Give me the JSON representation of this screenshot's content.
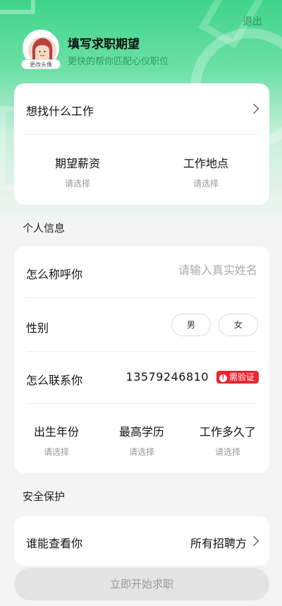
{
  "header": {
    "logout": "退出",
    "avatar_tag": "更改头像",
    "title": "填写求职期望",
    "subtitle": "更快的帮你匹配心仪职位"
  },
  "job_card": {
    "what_job": "想找什么工作",
    "salary_label": "期望薪资",
    "salary_value": "请选择",
    "location_label": "工作地点",
    "location_value": "请选择"
  },
  "personal_section": {
    "title": "个人信息",
    "name_label": "怎么称呼你",
    "name_placeholder": "请输入真实姓名",
    "gender_label": "性别",
    "gender_male": "男",
    "gender_female": "女",
    "contact_label": "怎么联系你",
    "phone": "13579246810",
    "verify_badge": "需验证",
    "birth_label": "出生年份",
    "birth_value": "请选择",
    "edu_label": "最高学历",
    "edu_value": "请选择",
    "exp_label": "工作多久了",
    "exp_value": "请选择"
  },
  "security_section": {
    "title": "安全保护",
    "who_can_see_label": "谁能查看你",
    "who_can_see_value": "所有招聘方"
  },
  "cta": {
    "label": "立即开始求职"
  },
  "colors": {
    "brand_green": "#3ed48a",
    "verify_red": "#e8262d"
  }
}
